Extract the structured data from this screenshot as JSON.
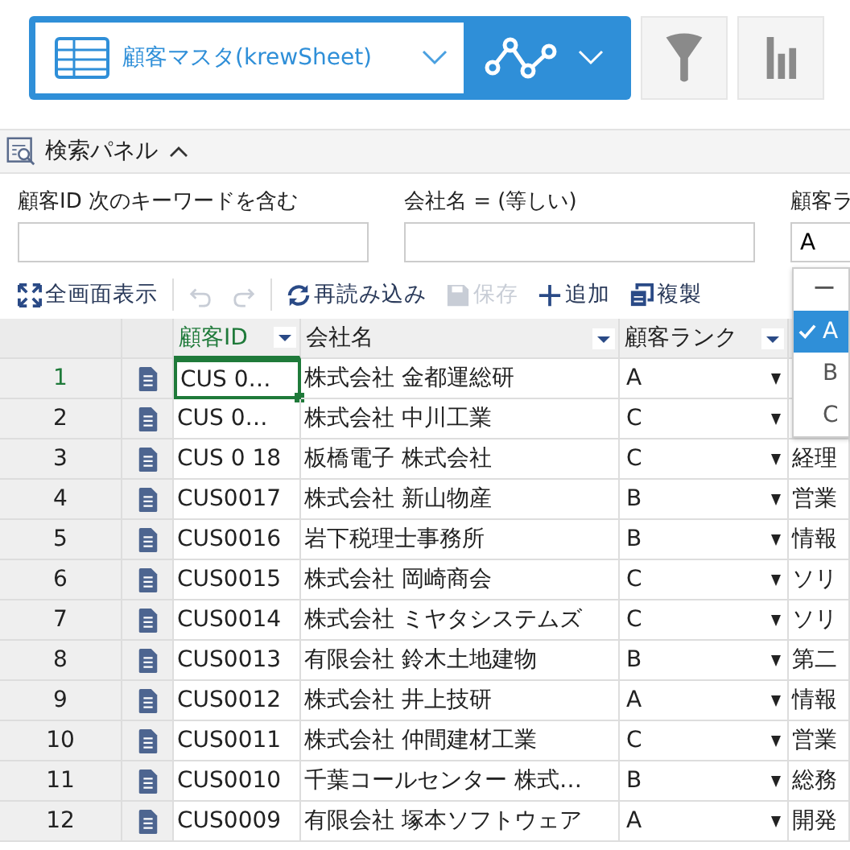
{
  "app_bar": {
    "view_name": "顧客マスタ(krewSheet)"
  },
  "search_panel": {
    "title": "検索パネル",
    "expanded": true,
    "filters": [
      {
        "label": "顧客ID 次のキーワードを含む"
      },
      {
        "label": "会社名 = (等しい)"
      },
      {
        "label": "顧客ラ",
        "value": "A"
      }
    ]
  },
  "toolbar": [
    {
      "kind": "fullscreen",
      "label": "全画面表示",
      "disabled": false
    },
    {
      "kind": "undo",
      "disabled": true
    },
    {
      "kind": "redo",
      "disabled": true
    },
    {
      "kind": "reload",
      "label": "再読み込み",
      "disabled": false
    },
    {
      "kind": "save",
      "label": "保存",
      "disabled": true
    },
    {
      "kind": "add",
      "label": "追加",
      "disabled": false
    },
    {
      "kind": "copy",
      "label": "複製",
      "disabled": false
    }
  ],
  "grid": {
    "columns": [
      {
        "label": "顧客ID",
        "selected": true
      },
      {
        "label": "会社名",
        "selected": false
      },
      {
        "label": "顧客ランク",
        "selected": false
      }
    ],
    "rows": [
      {
        "number": "1",
        "id": "CUS 0…",
        "company": " 株式会社 金都運総研",
        "rank": "A",
        "selected": true
      },
      {
        "number": "2",
        "id": "CUS 0…",
        "company": "株式会社 中川工業",
        "rank": "C",
        "selected": false
      },
      {
        "number": "3",
        "id": "CUS 0 18",
        "company": "板橋電子 株式会社",
        "rank": "C",
        "column_4": "経理",
        "selected": false
      },
      {
        "number": "4",
        "id": "CUS0017",
        "company": "株式会社 新山物産",
        "rank": "B",
        "column_4": "営業",
        "selected": false
      },
      {
        "number": "5",
        "id": "CUS0016",
        "company": "岩下税理士事務所",
        "rank": "B",
        "column_4": "情報",
        "selected": false
      },
      {
        "number": "6",
        "id": "CUS0015",
        "company": " 株式会社 岡崎商会",
        "rank": "C",
        "column_4": "ソリ",
        "selected": false
      },
      {
        "number": "7",
        "id": "CUS0014",
        "company": " 株式会社 ミヤタシステムズ",
        "rank": "C",
        "column_4": "ソリ",
        "selected": false
      },
      {
        "number": "8",
        "id": "CUS0013",
        "company": "有限会社 鈴木土地建物",
        "rank": "B",
        "column_4": "第二",
        "selected": false
      },
      {
        "number": "9",
        "id": "CUS0012",
        "company": "株式会社 井上技研",
        "rank": "A",
        "column_4": "情報",
        "selected": false
      },
      {
        "number": "10",
        "id": "CUS0011",
        "company": "株式会社 仲間建材工業",
        "rank": "C",
        "column_4": "営業",
        "selected": false
      },
      {
        "number": "11",
        "id": "CUS0010",
        "company": "千葉コールセンター 株式…",
        "rank": "B",
        "column_4": "総務",
        "selected": false
      },
      {
        "number": "12",
        "id": "CUS0009",
        "company": " 有限会社 塚本ソフトウェア",
        "rank": "A",
        "column_4": "開発",
        "selected": false
      }
    ]
  },
  "rank_dropdown": {
    "options": [
      {
        "label": "ー",
        "selected": false
      },
      {
        "label": "A",
        "selected": true
      },
      {
        "label": "B",
        "selected": false
      },
      {
        "label": "C",
        "selected": false
      }
    ]
  }
}
